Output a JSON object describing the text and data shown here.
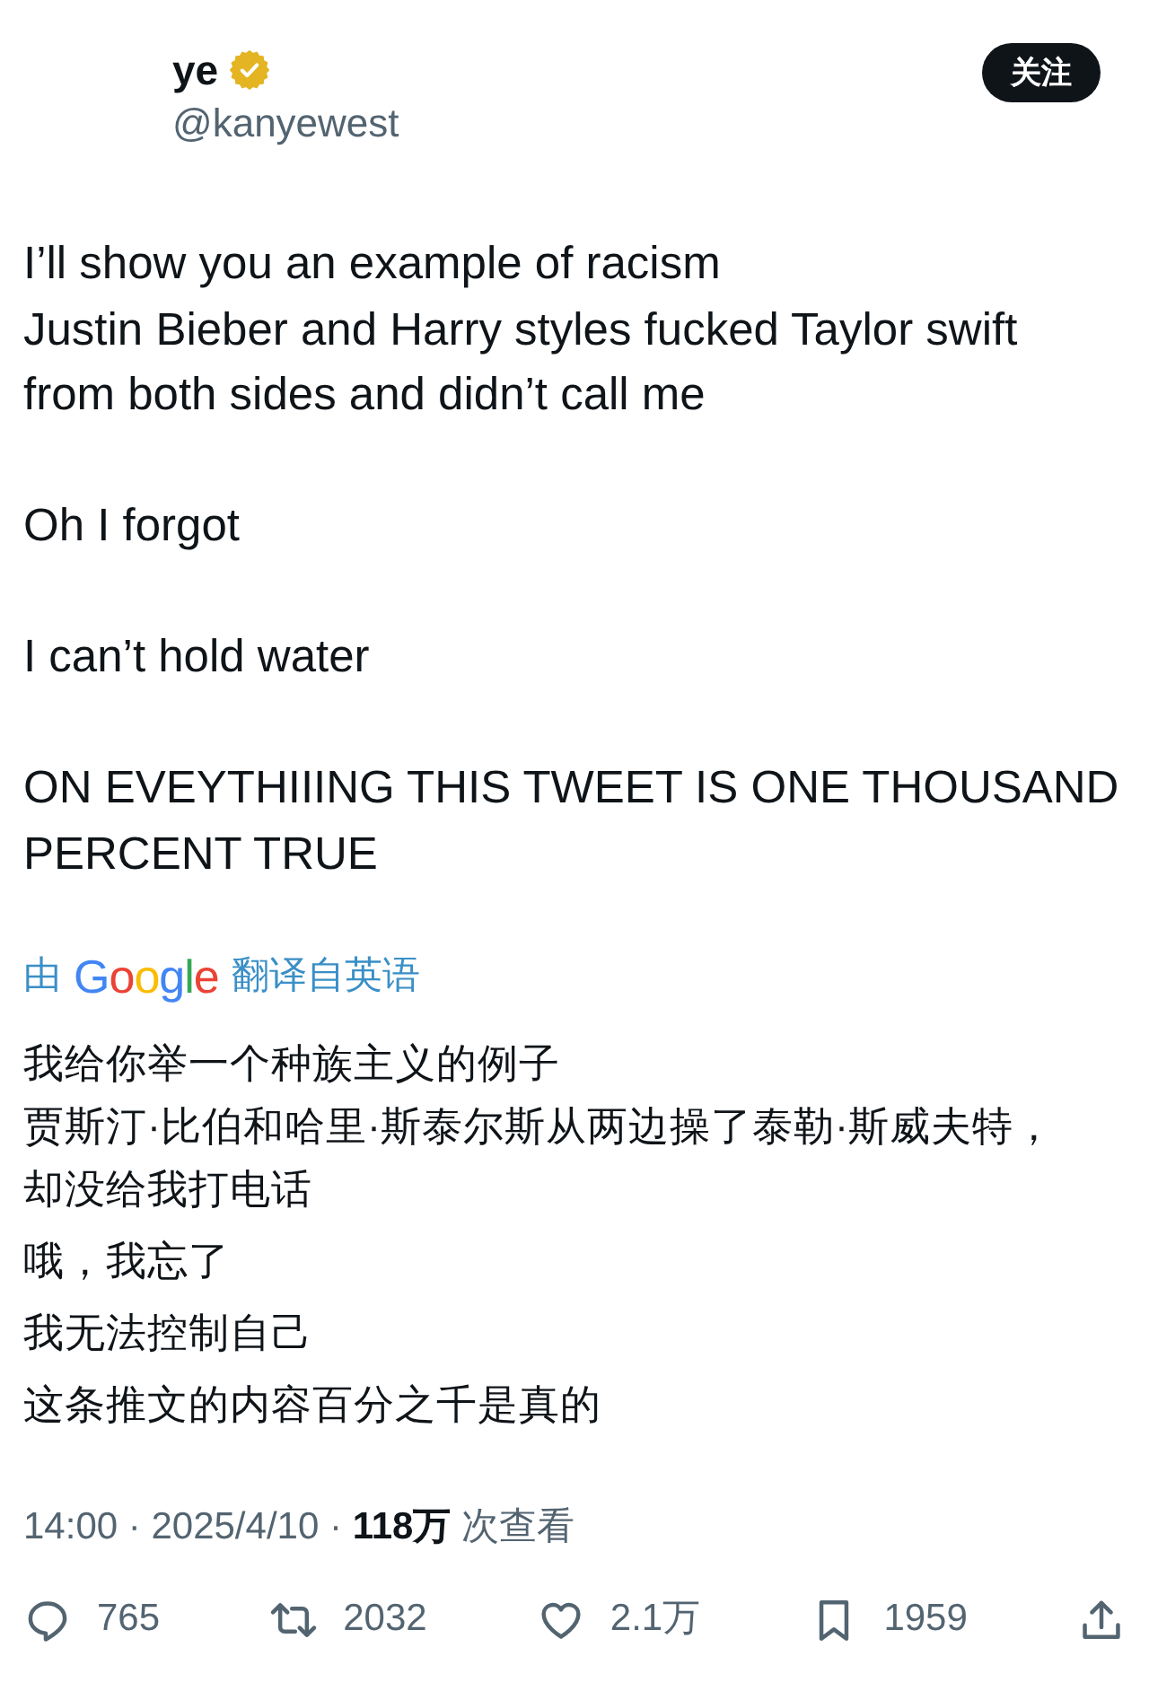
{
  "author": {
    "name": "ye",
    "verified": true,
    "handle": "@kanyewest"
  },
  "follow_button": {
    "label": "关注"
  },
  "tweet": {
    "paragraphs": [
      [
        "I’ll show you an example of racism",
        "Justin Bieber and Harry styles fucked Taylor swift",
        "from both sides and didn’t call me"
      ],
      [
        "Oh I forgot"
      ],
      [
        "I can’t hold water"
      ],
      [
        "ON EVEYTHIIING THIS TWEET IS ONE THOUSAND",
        "PERCENT TRUE"
      ]
    ]
  },
  "translation": {
    "prefix": "由",
    "provider": "Google",
    "label": "翻译自英语",
    "paragraphs": [
      [
        "我给你举一个种族主义的例子",
        "贾斯汀·比伯和哈里·斯泰尔斯从两边操了泰勒·斯威夫特，",
        "却没给我打电话"
      ],
      [
        "哦，我忘了"
      ],
      [
        "我无法控制自己"
      ],
      [
        "这条推文的内容百分之千是真的"
      ]
    ]
  },
  "meta": {
    "text": "14:00 · 2025/4/10 · **118万** 次查看"
  },
  "actions": [
    {
      "kind": "reply",
      "count": "765"
    },
    {
      "kind": "repost",
      "count": "2032"
    },
    {
      "kind": "like",
      "count": "2.1万"
    },
    {
      "kind": "bookmark",
      "count": "1959"
    },
    {
      "kind": "share"
    }
  ]
}
